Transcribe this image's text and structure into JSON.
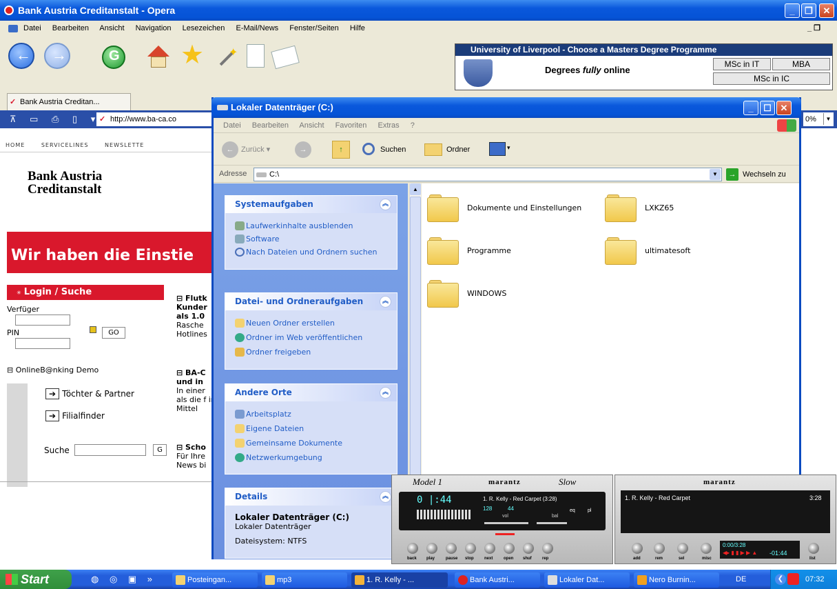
{
  "opera": {
    "title": "Bank Austria Creditanstalt - Opera",
    "menu": [
      "Datei",
      "Bearbeiten",
      "Ansicht",
      "Navigation",
      "Lesezeichen",
      "E-Mail/News",
      "Fenster/Seiten",
      "Hilfe"
    ],
    "tab_label": "Bank Austria Creditan...",
    "address": "http://www.ba-ca.co",
    "zoom": "0%",
    "ad": {
      "title": "University of Liverpool - Choose a Masters Degree Programme",
      "tagline_pre": "Degrees ",
      "tagline_em": "fully",
      "tagline_post": " online",
      "btn_msc_it": "MSc in IT",
      "btn_mba": "MBA",
      "btn_msc_ic": "MSc in IC"
    }
  },
  "bank": {
    "nav": [
      "HOME",
      "SERVICELINES",
      "NEWSLETTE"
    ],
    "logo_line1": "Bank Austria",
    "logo_line2": "Creditanstalt",
    "banner_text": "Wir haben die Einstie",
    "login_header": "Login / Suche",
    "verfuger": "Verfüger",
    "pin": "PIN",
    "go": "GO",
    "demo": "OnlineB@nking Demo",
    "toechter": "Töchter & Partner",
    "filialfinder": "Filialfinder",
    "suche": "Suche",
    "go2": "G",
    "news1_title": "Flutk Kunder als 1.0",
    "news1_body": "Rasche Hotlines",
    "news2_title": "BA-C und in",
    "news2_body": "In einer als die f in Mittel",
    "news3_title": "Scho",
    "news3_body": "Für Ihre News bi"
  },
  "explorer": {
    "title": "Lokaler Datenträger (C:)",
    "menu": [
      "Datei",
      "Bearbeiten",
      "Ansicht",
      "Favoriten",
      "Extras",
      "?"
    ],
    "back": "Zurück",
    "search": "Suchen",
    "folders": "Ordner",
    "address_label": "Adresse",
    "address_value": "C:\\",
    "go": "Wechseln zu",
    "panel_system": {
      "header": "Systemaufgaben",
      "items": [
        "Laufwerkinhalte ausblenden",
        "Software",
        "Nach Dateien und Ordnern suchen"
      ]
    },
    "panel_files": {
      "header": "Datei- und Ordneraufgaben",
      "items": [
        "Neuen Ordner erstellen",
        "Ordner im Web veröffentlichen",
        "Ordner freigeben"
      ]
    },
    "panel_places": {
      "header": "Andere Orte",
      "items": [
        "Arbeitsplatz",
        "Eigene Dateien",
        "Gemeinsame Dokumente",
        "Netzwerkumgebung"
      ]
    },
    "panel_details": {
      "header": "Details",
      "name": "Lokaler Datenträger (C:)",
      "type": "Lokaler Datenträger",
      "fs": "Dateisystem: NTFS"
    },
    "files": [
      "Dokumente und Einstellungen",
      "LXKZ65",
      "Programme",
      "ultimatesoft",
      "WINDOWS"
    ]
  },
  "player": {
    "model": "Model 1",
    "brand": "marantz",
    "script": "Slow",
    "time": "0 |:44",
    "track": "1. R. Kelly - Red Carpet (3:28)",
    "kbps": "128",
    "khz": "44",
    "vol": "vol",
    "bal": "bal",
    "eq": "eq",
    "pl": "pl",
    "controls": [
      "back",
      "play",
      "pause",
      "stop",
      "next",
      "open",
      "shuf",
      "rep"
    ],
    "pl_brand": "marantz",
    "pl_track": "1. R. Kelly - Red Carpet",
    "pl_len": "3:28",
    "pl_time": "0:00/3:28",
    "pl_remain": "-01:44",
    "pl_controls": [
      "add",
      "rem",
      "sel",
      "misc",
      "list"
    ]
  },
  "taskbar": {
    "start": "Start",
    "items": [
      "Posteingan...",
      "mp3",
      "1. R. Kelly - ...",
      "Bank Austri...",
      "Lokaler Dat...",
      "Nero Burnin..."
    ],
    "lang": "DE",
    "clock": "07:32"
  },
  "colors": {
    "xp_blue": "#0a58dc",
    "bank_red": "#d9182c",
    "panel_blue": "#6b8fdf"
  }
}
